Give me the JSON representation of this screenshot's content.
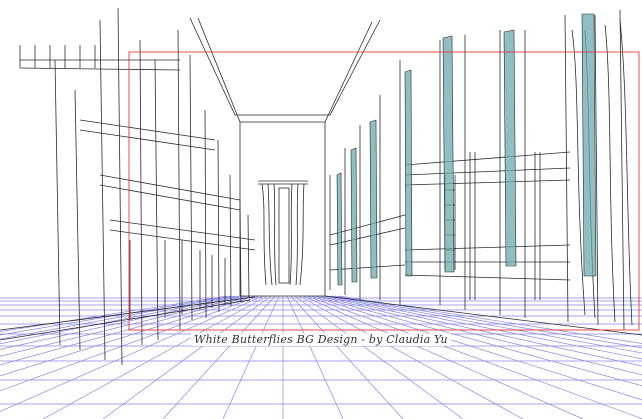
{
  "caption": "White Butterflies BG Design - by Claudia Yu",
  "colors": {
    "background": "#ffffff",
    "line_art": "#2b2b2b",
    "floor_grid": "#8a88e6",
    "frame_red": "#e33b3b",
    "curtain_teal": "#6aa9ad"
  }
}
